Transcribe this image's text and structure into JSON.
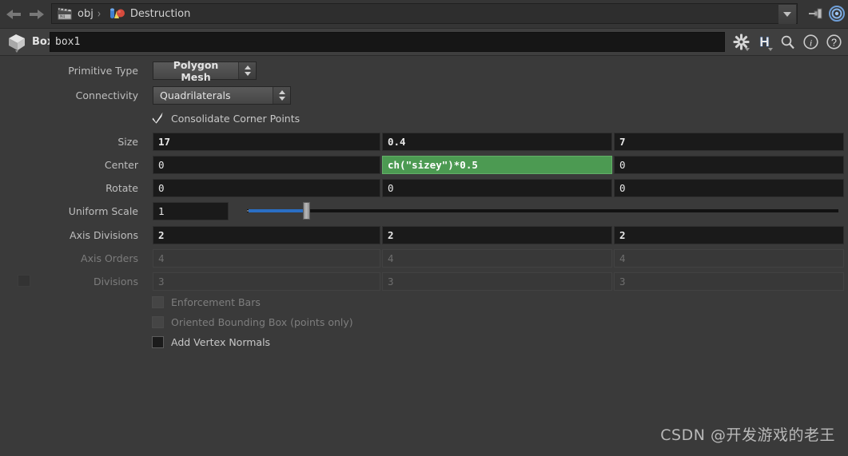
{
  "topbar": {
    "back_icon": "arrow-left-icon",
    "forward_icon": "arrow-right-icon",
    "breadcrumb": [
      {
        "icon": "clapperboard-icon",
        "label": "obj"
      },
      {
        "icon": "geometry-object-icon",
        "label": "Destruction"
      }
    ],
    "separator": "›",
    "dropdown_icon": "chevron-down-icon",
    "pin_icon": "pin-icon",
    "target_icon": "target-icon"
  },
  "nodebar": {
    "node_icon": "box-node-icon",
    "node_type": "Box",
    "node_name": "box1",
    "icons": [
      {
        "name": "gear-icon",
        "glyph": "⚙"
      },
      {
        "name": "houdini-h-icon",
        "glyph": "H"
      },
      {
        "name": "search-icon",
        "glyph": "⚲"
      },
      {
        "name": "info-icon",
        "glyph": "i"
      },
      {
        "name": "help-icon",
        "glyph": "?"
      }
    ]
  },
  "parameters": {
    "primitive_type": {
      "label": "Primitive Type",
      "value": "Polygon Mesh"
    },
    "connectivity": {
      "label": "Connectivity",
      "value": "Quadrilaterals"
    },
    "consolidate_corner_points": {
      "label": "Consolidate Corner Points",
      "checked": true
    },
    "size": {
      "label": "Size",
      "values": [
        "17",
        "0.4",
        "7"
      ],
      "bold": true
    },
    "center": {
      "label": "Center",
      "values": [
        "0",
        "ch(\"sizey\")*0.5",
        "0"
      ],
      "expression_index": 1
    },
    "rotate": {
      "label": "Rotate",
      "values": [
        "0",
        "0",
        "0"
      ]
    },
    "uniform_scale": {
      "label": "Uniform Scale",
      "value": "1"
    },
    "axis_divisions": {
      "label": "Axis Divisions",
      "values": [
        "2",
        "2",
        "2"
      ],
      "bold": true
    },
    "axis_orders": {
      "label": "Axis Orders",
      "values": [
        "4",
        "4",
        "4"
      ],
      "disabled": true
    },
    "divisions": {
      "label": "Divisions",
      "values": [
        "3",
        "3",
        "3"
      ],
      "disabled": true
    },
    "enforcement_bars": {
      "label": "Enforcement Bars",
      "checked": false,
      "disabled": true
    },
    "oriented_bounding_box": {
      "label": "Oriented Bounding Box (points only)",
      "checked": false,
      "disabled": true
    },
    "add_vertex_normals": {
      "label": "Add Vertex Normals",
      "checked": false,
      "disabled": false
    }
  },
  "watermark": "CSDN @开发游戏的老王",
  "colors": {
    "background": "#3a3a3a",
    "field_background": "#1a1a1a",
    "expression_green": "#4c9a52",
    "slider_blue": "#2a6ec4"
  }
}
